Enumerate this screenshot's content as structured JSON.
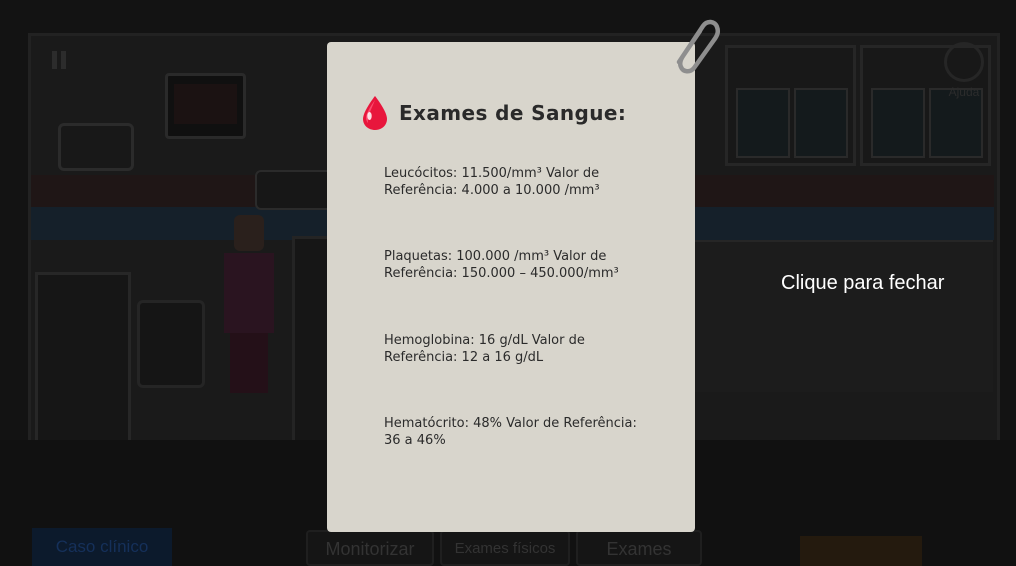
{
  "background": {
    "buttons": {
      "case": "Caso clínico",
      "monitor": "Monitorizar",
      "physical_exams": "Exames físicos",
      "exams": "Exames"
    },
    "help_label": "Ajuda",
    "pause_icon": "pause-icon",
    "help_icon": "question-mark-icon"
  },
  "modal": {
    "icon": "blood-drop-icon",
    "clip_icon": "paperclip-icon",
    "title": "Exames de Sangue:",
    "results": [
      {
        "text": "Leucócitos: 11.500/mm³ Valor de Referência: 4.000 a 10.000 /mm³"
      },
      {
        "text": "Plaquetas: 100.000 /mm³ Valor de Referência: 150.000 – 450.000/mm³"
      },
      {
        "text": "Hemoglobina: 16 g/dL Valor de Referência: 12 a 16 g/dL"
      },
      {
        "text": "Hematócrito: 48% Valor de Referência: 36 a 46%"
      }
    ],
    "close_hint": "Clique para fechar"
  },
  "colors": {
    "card_bg": "#d8d5cc",
    "drop_red": "#e8163c",
    "overlay": "#000000"
  }
}
